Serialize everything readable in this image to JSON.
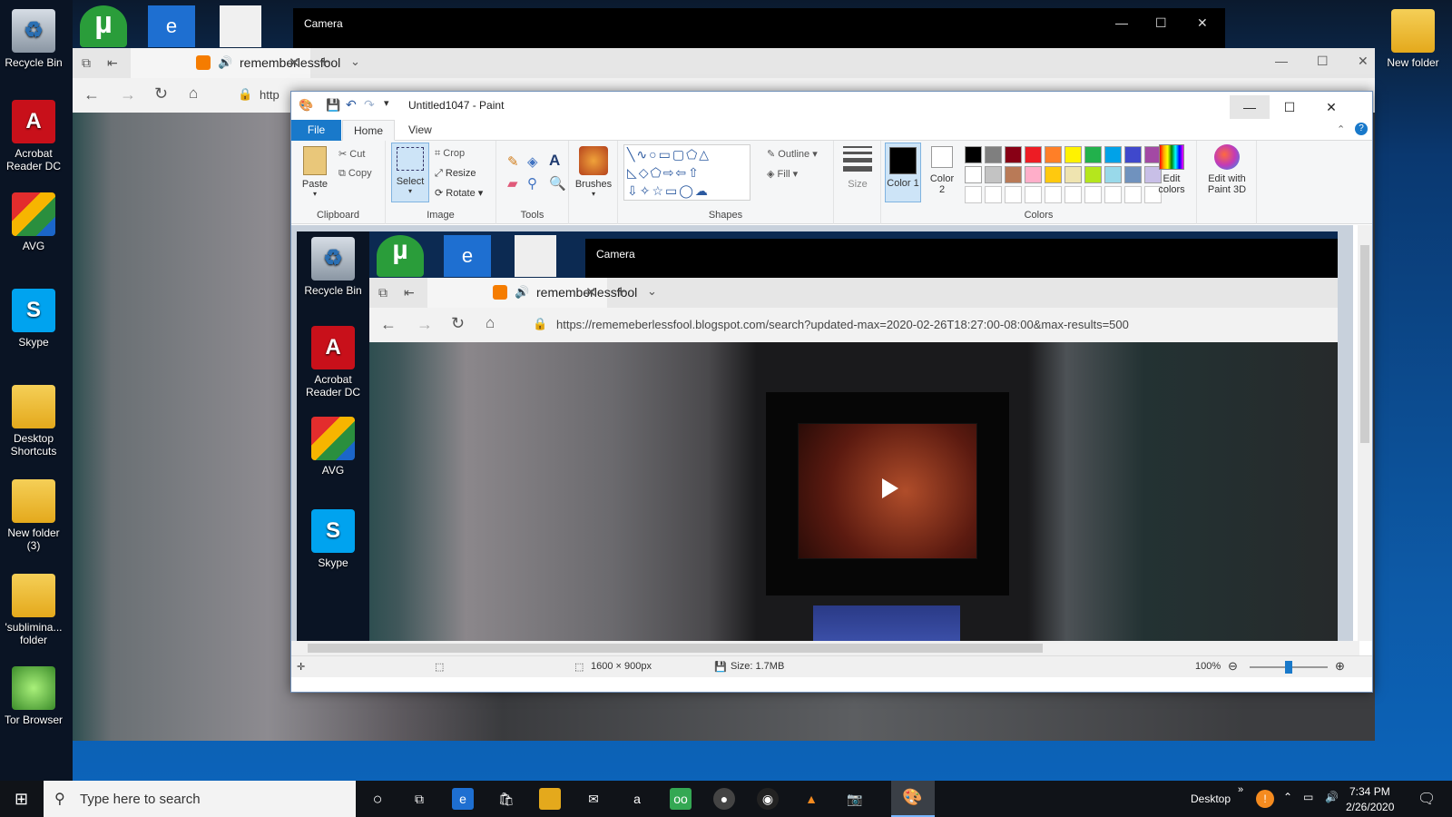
{
  "desktop": {
    "left_icons": [
      {
        "label": "Recycle Bin"
      },
      {
        "label": "Acrobat Reader DC"
      },
      {
        "label": "AVG"
      },
      {
        "label": "Skype"
      },
      {
        "label": "Desktop Shortcuts"
      },
      {
        "label": "New folder (3)"
      },
      {
        "label": "'sublimina... folder"
      },
      {
        "label": "Tor Browser"
      }
    ],
    "right_icons": [
      {
        "label": "New folder"
      }
    ]
  },
  "camera_window": {
    "title": "Camera"
  },
  "edge": {
    "tab_title": "rememberlessfool",
    "address_partial": "http"
  },
  "paint": {
    "title": "Untitled1047 - Paint",
    "tabs": [
      "File",
      "Home",
      "View"
    ],
    "clipboard": {
      "paste": "Paste",
      "cut": "Cut",
      "copy": "Copy",
      "group": "Clipboard"
    },
    "image": {
      "select": "Select",
      "crop": "Crop",
      "resize": "Resize",
      "rotate": "Rotate",
      "group": "Image"
    },
    "tools": {
      "group": "Tools"
    },
    "brushes": {
      "label": "Brushes"
    },
    "shapes": {
      "outline": "Outline",
      "fill": "Fill",
      "group": "Shapes"
    },
    "size": {
      "label": "Size"
    },
    "colors": {
      "color1": "Color 1",
      "color2": "Color 2",
      "edit": "Edit colors",
      "paint3d": "Edit with Paint 3D",
      "group": "Colors",
      "palette_row1": [
        "#000000",
        "#7f7f7f",
        "#880015",
        "#ed1c24",
        "#ff7f27",
        "#fff200",
        "#22b14c",
        "#00a2e8",
        "#3f48cc",
        "#a349a4"
      ],
      "palette_row2": [
        "#ffffff",
        "#c3c3c3",
        "#b97a57",
        "#ffaec9",
        "#ffc90e",
        "#efe4b0",
        "#b5e61d",
        "#99d9ea",
        "#7092be",
        "#c8bfe7"
      ]
    },
    "status": {
      "dimensions": "1600 × 900px",
      "size": "Size: 1.7MB",
      "zoom": "100%"
    },
    "zoom_level": 0.5
  },
  "inner_screenshot": {
    "left_icons": [
      {
        "label": "Recycle Bin"
      },
      {
        "label": "Acrobat Reader DC"
      },
      {
        "label": "AVG"
      },
      {
        "label": "Skype"
      }
    ],
    "camera_title": "Camera",
    "tab_title": "rememberlessfool",
    "url": "https://rememeberlessfool.blogspot.com/search?updated-max=2020-02-26T18:27:00-08:00&max-results=500"
  },
  "taskbar": {
    "search_placeholder": "Type here to search",
    "desktop_label": "Desktop",
    "time": "7:34 PM",
    "date": "2/26/2020"
  }
}
